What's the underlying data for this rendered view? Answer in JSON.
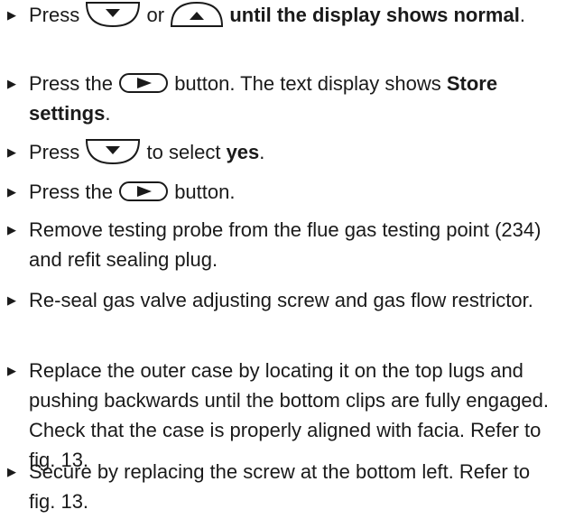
{
  "bullet_glyph": "▶",
  "steps": [
    {
      "pre": "Press",
      "or": "or",
      "bold": "until the display shows normal",
      "post": "."
    },
    {
      "pre": "Press the",
      "post1": "button. The text display shows",
      "bold": "Store settings",
      "post2": "."
    },
    {
      "pre": "Press",
      "post1": "to select",
      "bold": "yes",
      "post2": "."
    },
    {
      "pre": "Press the",
      "post": "button."
    },
    {
      "text": "Remove testing probe from the flue gas testing point (234) and refit sealing plug."
    },
    {
      "text": "Re-seal gas valve adjusting screw and gas flow restrictor."
    },
    {
      "text": "Replace the outer case by locating it on the top lugs and pushing backwards until the bottom clips are fully engaged. Check that the case is properly aligned with facia. Refer to fig. 13."
    },
    {
      "text": "Secure by replacing the screw at the bottom left. Refer to fig. 13."
    }
  ],
  "icons": {
    "down": "down-arrow-button-icon",
    "up": "up-arrow-button-icon",
    "right": "right-arrow-button-icon"
  }
}
